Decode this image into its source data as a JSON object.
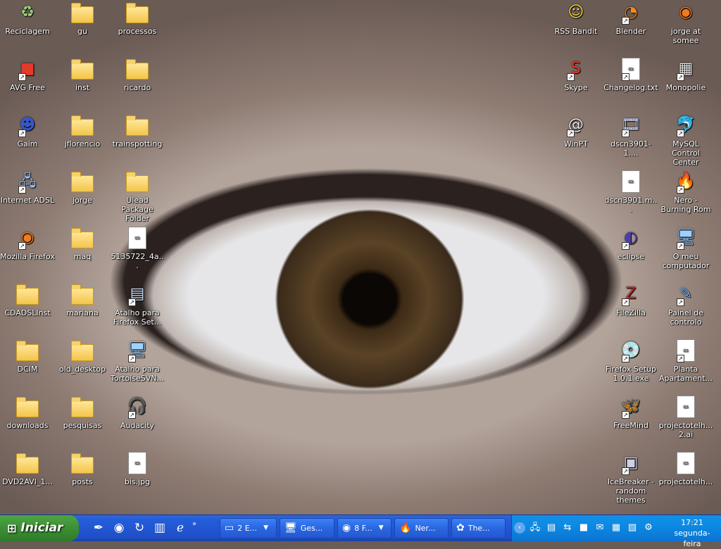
{
  "desktop_icons_left": [
    {
      "label": "Reciclagem",
      "icon": "recycle-bin-icon",
      "kind": "glyph",
      "glyph": "♻",
      "color": "#9bd07a"
    },
    {
      "label": "gu",
      "icon": "folder-icon",
      "kind": "folder"
    },
    {
      "label": "processos",
      "icon": "folder-icon",
      "kind": "folder"
    },
    {
      "label": "AVG Free",
      "icon": "avg-icon",
      "kind": "glyph",
      "glyph": "■",
      "color": "#e23b2a",
      "shortcut": true
    },
    {
      "label": "inst",
      "icon": "folder-icon",
      "kind": "folder"
    },
    {
      "label": "ricardo",
      "icon": "folder-icon",
      "kind": "folder"
    },
    {
      "label": "Gaim",
      "icon": "gaim-icon",
      "kind": "glyph",
      "glyph": "☻",
      "color": "#3557c8",
      "shortcut": true
    },
    {
      "label": "jflorencio",
      "icon": "folder-icon",
      "kind": "folder"
    },
    {
      "label": "trainspotting",
      "icon": "folder-icon",
      "kind": "folder"
    },
    {
      "label": "Internet ADSL",
      "icon": "network-icon",
      "kind": "glyph",
      "glyph": "🖧",
      "color": "#9ec9ff",
      "shortcut": true
    },
    {
      "label": "jorge",
      "icon": "folder-icon",
      "kind": "folder"
    },
    {
      "label": "Ulead Package Folder",
      "icon": "folder-icon",
      "kind": "folder"
    },
    {
      "label": "Mozilla Firefox",
      "icon": "firefox-icon",
      "kind": "glyph",
      "glyph": "◉",
      "color": "#f07a1e",
      "shortcut": true
    },
    {
      "label": "maq",
      "icon": "folder-icon",
      "kind": "folder"
    },
    {
      "label": "5135722_4a...",
      "icon": "image-file-icon",
      "kind": "file"
    },
    {
      "label": "CDADSLInst",
      "icon": "folder-icon",
      "kind": "folder"
    },
    {
      "label": "mariana",
      "icon": "folder-icon",
      "kind": "folder"
    },
    {
      "label": "Atalho para Firefox Set...",
      "icon": "window-icon",
      "kind": "glyph",
      "glyph": "▤",
      "color": "#cfe0ff",
      "shortcut": true
    },
    {
      "label": "DCIM",
      "icon": "folder-icon",
      "kind": "folder"
    },
    {
      "label": "old_desktop",
      "icon": "folder-icon",
      "kind": "folder"
    },
    {
      "label": "Atalho para TortoiseSVN...",
      "icon": "tortoisesvn-icon",
      "kind": "glyph",
      "glyph": "🖥",
      "color": "#9fd0ff",
      "shortcut": true
    },
    {
      "label": "downloads",
      "icon": "folder-icon",
      "kind": "folder"
    },
    {
      "label": "pesquisas",
      "icon": "folder-icon",
      "kind": "folder"
    },
    {
      "label": "Audacity",
      "icon": "audacity-icon",
      "kind": "glyph",
      "glyph": "🎧",
      "color": "#f3b22f",
      "shortcut": true
    },
    {
      "label": "DVD2AVI_1...",
      "icon": "folder-icon",
      "kind": "folder"
    },
    {
      "label": "posts",
      "icon": "folder-icon",
      "kind": "folder"
    },
    {
      "label": "bis.jpg",
      "icon": "image-file-icon",
      "kind": "file"
    }
  ],
  "desktop_icons_right": [
    {
      "label": "RSS Bandit",
      "icon": "rss-bandit-icon",
      "kind": "glyph",
      "glyph": "☺",
      "color": "#f5d33c"
    },
    {
      "label": "Blender",
      "icon": "blender-icon",
      "kind": "glyph",
      "glyph": "◔",
      "color": "#f28b1b",
      "shortcut": true
    },
    {
      "label": "jorge at somee",
      "icon": "firefox-file-icon",
      "kind": "glyph",
      "glyph": "◉",
      "color": "#f07a1e"
    },
    {
      "label": "Skype",
      "icon": "skype-icon",
      "kind": "glyph",
      "glyph": "S",
      "color": "#e8362d",
      "shortcut": true
    },
    {
      "label": "Changelog.txt",
      "icon": "text-file-icon",
      "kind": "file",
      "shortcut": true
    },
    {
      "label": "Monopolie",
      "icon": "monopoly-icon",
      "kind": "glyph",
      "glyph": "▦",
      "color": "#e6e6e6",
      "shortcut": true
    },
    {
      "label": "WinPT",
      "icon": "winpt-icon",
      "kind": "glyph",
      "glyph": "@",
      "color": "#e6e6e6",
      "shortcut": true
    },
    {
      "label": "dscn3901-1....",
      "icon": "movie-file-icon",
      "kind": "glyph",
      "glyph": "🎞",
      "color": "#cfd8ff",
      "shortcut": true
    },
    {
      "label": "MySQL Control Center",
      "icon": "mysql-icon",
      "kind": "glyph",
      "glyph": "🐬",
      "color": "#9fd0ff",
      "shortcut": true
    },
    {
      "label": "dscn3901.m...",
      "icon": "image-file-icon",
      "kind": "file"
    },
    {
      "label": "Nero - Burning Rom",
      "icon": "nero-icon",
      "kind": "glyph",
      "glyph": "🔥",
      "color": "#ff5a1e",
      "shortcut": true
    },
    {
      "label": "eclipse",
      "icon": "eclipse-icon",
      "kind": "glyph",
      "glyph": "◐",
      "color": "#4b3fb0",
      "shortcut": true
    },
    {
      "label": "O meu computador",
      "icon": "my-computer-icon",
      "kind": "glyph",
      "glyph": "🖥",
      "color": "#9fd0ff",
      "shortcut": true
    },
    {
      "label": "FileZilla",
      "icon": "filezilla-icon",
      "kind": "glyph",
      "glyph": "Z",
      "color": "#c3272b",
      "shortcut": true
    },
    {
      "label": "Painel de controlo",
      "icon": "control-panel-icon",
      "kind": "glyph",
      "glyph": "✎",
      "color": "#7fb7ff",
      "shortcut": true
    },
    {
      "label": "Firefox Setup 1.0.1.exe",
      "icon": "installer-icon",
      "kind": "glyph",
      "glyph": "💿",
      "color": "#cfe0ff",
      "shortcut": true
    },
    {
      "label": "Planta Apartament...",
      "icon": "image-file-icon",
      "kind": "file",
      "shortcut": true
    },
    {
      "label": "FreeMind",
      "icon": "freemind-icon",
      "kind": "glyph",
      "glyph": "🦋",
      "color": "#f29c1f",
      "shortcut": true
    },
    {
      "label": "projectotelh... 2.ai",
      "icon": "ai-file-icon",
      "kind": "file"
    },
    {
      "label": "IceBreaker - random themes",
      "icon": "icebreaker-icon",
      "kind": "glyph",
      "glyph": "▣",
      "color": "#d0d0e8",
      "shortcut": true
    },
    {
      "label": "projectotelh...",
      "icon": "ai-file-icon",
      "kind": "file"
    }
  ],
  "taskbar": {
    "start_label": "Iniciar",
    "quick_launch": [
      {
        "icon": "pen-icon",
        "glyph": "✒"
      },
      {
        "icon": "firefox-icon",
        "glyph": "◉"
      },
      {
        "icon": "refresh-icon",
        "glyph": "↻"
      },
      {
        "icon": "notepad-icon",
        "glyph": "▥"
      },
      {
        "icon": "internet-explorer-icon",
        "glyph": "ℯ"
      }
    ],
    "quick_launch_more": "»",
    "tasks": [
      {
        "label": "2 E...",
        "icon": "folder-icon",
        "glyph": "▭",
        "group": true
      },
      {
        "label": "Ges...",
        "icon": "computer-icon",
        "glyph": "🖥",
        "group": false
      },
      {
        "label": "8 F...",
        "icon": "firefox-icon",
        "glyph": "◉",
        "group": true
      },
      {
        "label": "Ner...",
        "icon": "nero-icon",
        "glyph": "🔥",
        "group": false
      },
      {
        "label": "The...",
        "icon": "gimp-icon",
        "glyph": "✿",
        "group": false
      }
    ],
    "tray_expand": "‹",
    "tray_icons": [
      {
        "icon": "network-tray-icon",
        "glyph": "🖧"
      },
      {
        "icon": "monitor-tray-icon",
        "glyph": "▤"
      },
      {
        "icon": "network-connections-icon",
        "glyph": "⇆"
      },
      {
        "icon": "avg-tray-icon",
        "glyph": "■"
      },
      {
        "icon": "mail-icon",
        "glyph": "✉"
      },
      {
        "icon": "grid-tray-icon",
        "glyph": "▦"
      },
      {
        "icon": "color-tray-icon",
        "glyph": "▧"
      },
      {
        "icon": "gear-tray-icon",
        "glyph": "⚙"
      }
    ],
    "clock_time": "17:21",
    "clock_day": "segunda-feira"
  }
}
